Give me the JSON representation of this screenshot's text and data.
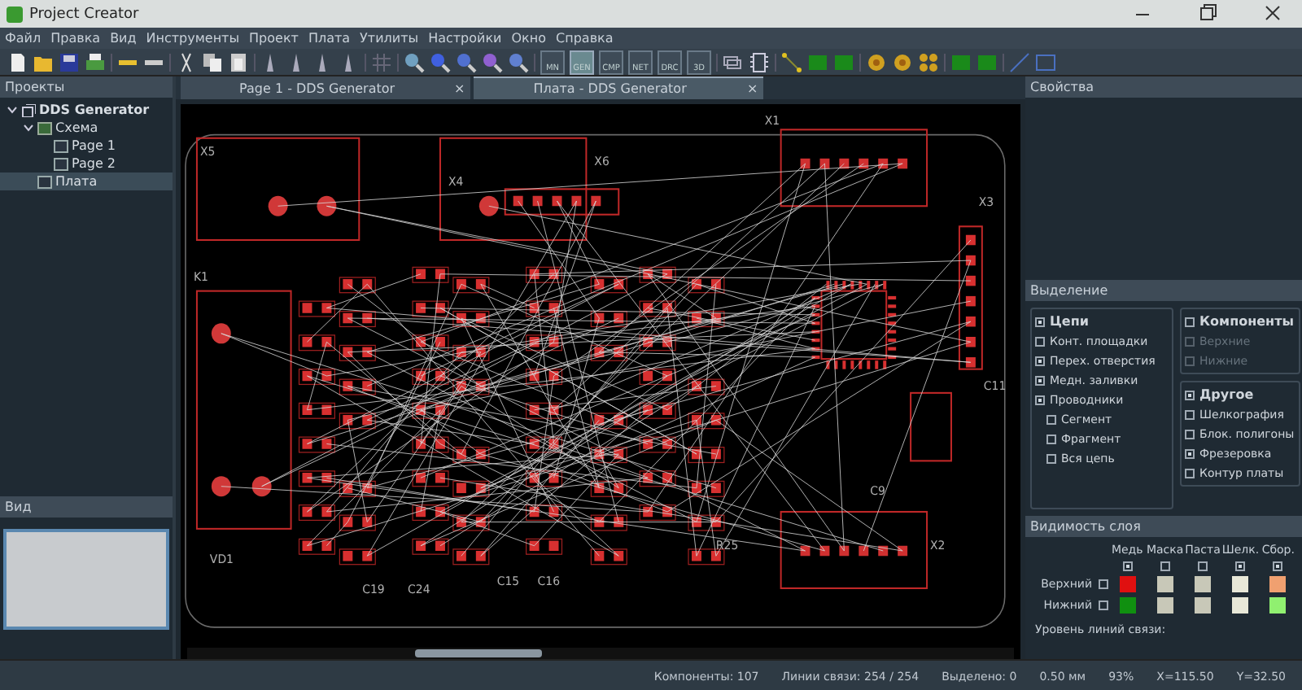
{
  "window": {
    "title": "Project Creator"
  },
  "menu": [
    "Файл",
    "Правка",
    "Вид",
    "Инструменты",
    "Проект",
    "Плата",
    "Утилиты",
    "Настройки",
    "Окно",
    "Справка"
  ],
  "mode_buttons": [
    {
      "label": "MN",
      "selected": false
    },
    {
      "label": "GEN",
      "selected": true
    },
    {
      "label": "CMP",
      "selected": false
    },
    {
      "label": "NET",
      "selected": false
    },
    {
      "label": "DRC",
      "selected": false
    },
    {
      "label": "3D",
      "selected": false
    }
  ],
  "projects_panel": {
    "title": "Проекты",
    "tree": [
      {
        "label": "DDS Generator",
        "selected": false,
        "expanded": true,
        "children": [
          {
            "label": "Схема",
            "selected": false,
            "expanded": true,
            "children": [
              {
                "label": "Page 1",
                "selected": false
              },
              {
                "label": "Page 2",
                "selected": false
              }
            ]
          },
          {
            "label": "Плата",
            "selected": true
          }
        ]
      }
    ]
  },
  "view_panel": {
    "title": "Вид"
  },
  "tabs": [
    {
      "label": "Page 1 - DDS Generator",
      "close": "×",
      "selected": false
    },
    {
      "label": "Плата - DDS Generator",
      "close": "×",
      "selected": true
    }
  ],
  "canvas": {
    "designators": [
      "X5",
      "X6",
      "X1",
      "X4",
      "X3",
      "K1",
      "X2",
      "VD1",
      "C19",
      "C24",
      "C15",
      "C16",
      "C11",
      "C9",
      "R25"
    ]
  },
  "properties_panel": {
    "title": "Свойства"
  },
  "selection_panel": {
    "title": "Выделение",
    "groups": [
      {
        "label": "Цепи",
        "checked": true,
        "items": [
          {
            "label": "Конт. площадки",
            "checked": false,
            "disabled": false
          },
          {
            "label": "Перех. отверстия",
            "checked": true,
            "disabled": false
          },
          {
            "label": "Медн. заливки",
            "checked": true,
            "disabled": false
          },
          {
            "label": "Проводники",
            "checked": true,
            "disabled": false,
            "children": [
              {
                "label": "Сегмент",
                "checked": false,
                "disabled": false
              },
              {
                "label": "Фрагмент",
                "checked": false,
                "disabled": false
              },
              {
                "label": "Вся цепь",
                "checked": false,
                "disabled": false
              }
            ]
          }
        ]
      },
      {
        "label": "Компоненты",
        "checked": false,
        "items": [
          {
            "label": "Верхние",
            "checked": false,
            "disabled": true
          },
          {
            "label": "Нижние",
            "checked": false,
            "disabled": true
          }
        ]
      },
      {
        "label": "Другое",
        "checked": true,
        "items": [
          {
            "label": "Шелкография",
            "checked": false,
            "disabled": false
          },
          {
            "label": "Блок. полигоны",
            "checked": false,
            "disabled": false
          },
          {
            "label": "Фрезеровка",
            "checked": true,
            "disabled": false
          },
          {
            "label": "Контур платы",
            "checked": false,
            "disabled": false
          }
        ]
      }
    ]
  },
  "layers_panel": {
    "title": "Видимость слоя",
    "columns": [
      {
        "label": "Медь",
        "checked": true
      },
      {
        "label": "Маска",
        "checked": false
      },
      {
        "label": "Паста",
        "checked": false
      },
      {
        "label": "Шелк.",
        "checked": true
      },
      {
        "label": "Сбор.",
        "checked": true
      }
    ],
    "rows": [
      {
        "label": "Верхний",
        "checked": false,
        "swatches": [
          {
            "color": "#e01010"
          },
          {
            "color": "#c8c8b8"
          },
          {
            "color": "#c8c8b8"
          },
          {
            "color": "#e8e8d8"
          },
          {
            "color": "#f0a070"
          }
        ]
      },
      {
        "label": "Нижний",
        "checked": false,
        "swatches": [
          {
            "color": "#109010"
          },
          {
            "color": "#c8c8b8"
          },
          {
            "color": "#c8c8b8"
          },
          {
            "color": "#e8e8d8"
          },
          {
            "color": "#90f070"
          }
        ]
      }
    ],
    "ratsnest_label": "Уровень линий связи:"
  },
  "status_bar": [
    "Компоненты: 107",
    "Линии связи: 254 / 254",
    "Выделено: 0",
    "0.50 мм",
    "93%",
    "X=115.50",
    "Y=32.50"
  ]
}
